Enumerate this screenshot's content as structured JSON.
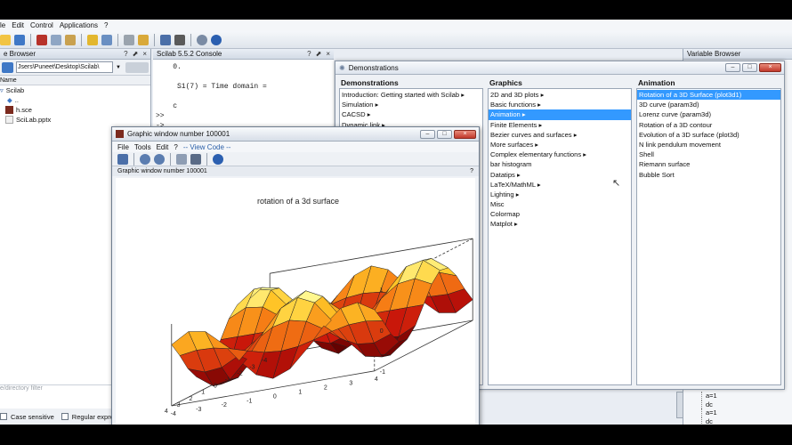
{
  "menubar": [
    "le",
    "Edit",
    "Control",
    "Applications",
    "?"
  ],
  "file_browser": {
    "title": "e Browser",
    "path": "Jsers\\Puneet\\Desktop\\Scilab\\",
    "column": "Name",
    "items": [
      "Scilab",
      "..",
      "h.sce",
      "SciLab.pptx"
    ],
    "filter_placeholder": "e/directory filter",
    "case_sensitive": "Case sensitive",
    "regular_expr": "Regular expressi"
  },
  "console": {
    "title": "Scilab 5.5.2 Console",
    "lines": [
      "    0.",
      "",
      "     S1(7) = Time domain =",
      "",
      "    c",
      ">>",
      "->"
    ]
  },
  "variable_browser": {
    "title": "Variable Browser",
    "items": [
      "a=1",
      "dc",
      "a=1",
      "dc"
    ]
  },
  "demo": {
    "title": "Demonstrations",
    "col1_header": "Demonstrations",
    "col1": [
      "Introduction: Getting started with Scilab ▸",
      "Simulation ▸",
      "CACSD ▸",
      "Dynamic link ▸"
    ],
    "col2_header": "Graphics",
    "col2": [
      "2D and 3D plots ▸",
      "Basic functions ▸",
      "Animation ▸",
      "Finite Elements ▸",
      "Bezier curves and surfaces ▸",
      "More surfaces ▸",
      "Complex elementary functions ▸",
      "bar histogram",
      "Datatips ▸",
      "LaTeX/MathML ▸",
      "Lighting ▸",
      "Misc",
      "Colormap",
      "Matplot ▸"
    ],
    "col2_selected": 2,
    "col3_header": "Animation",
    "col3": [
      "Rotation of a 3D Surface (plot3d1)",
      "3D curve (param3d)",
      "Lorenz curve (param3d)",
      "Rotation of a 3D contour",
      "Evolution of a 3D surface (plot3d)",
      "N link pendulum movement",
      "Shell",
      "Riemann surface",
      "Bubble Sort"
    ],
    "col3_selected": 0
  },
  "graphic": {
    "title": "Graphic window number 100001",
    "menu": [
      "File",
      "Tools",
      "Edit",
      "?",
      "-- View Code --"
    ],
    "status": "Graphic window number 100001",
    "plot_title": "rotation of a 3d surface",
    "ticks_left": [
      "-4",
      "-3",
      "-2",
      "-1",
      "0",
      "1",
      "2",
      "3",
      "4"
    ],
    "ticks_bottom": [
      "4",
      "3",
      "2",
      "1",
      "0",
      "-1",
      "-2",
      "-3",
      "-4"
    ],
    "ticks_right": [
      "-1",
      "0",
      "1"
    ]
  }
}
